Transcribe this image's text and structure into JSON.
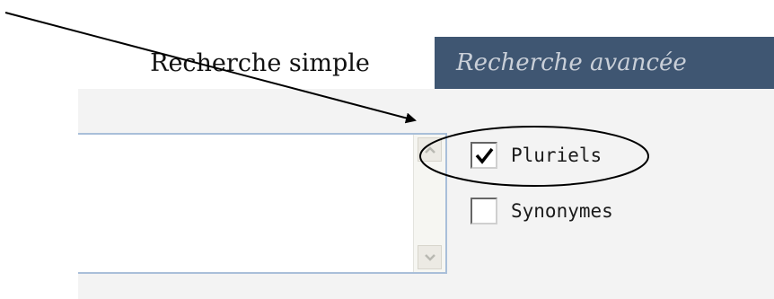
{
  "tabs": {
    "simple_label": "Recherche simple",
    "advanced_label": "Recherche avancée"
  },
  "search": {
    "value": ""
  },
  "options": [
    {
      "label": "Pluriels",
      "checked": true
    },
    {
      "label": "Synonymes",
      "checked": false
    }
  ],
  "annotation": {
    "arrow_color": "#000000",
    "ellipse_color": "#000000"
  },
  "colors": {
    "advanced_tab_bg": "#3f5672",
    "textarea_border": "#a9bfd9"
  }
}
